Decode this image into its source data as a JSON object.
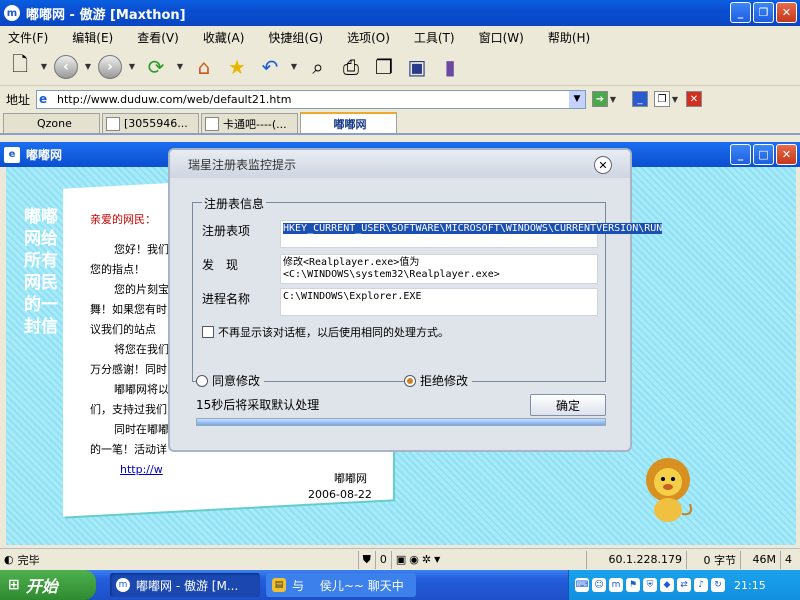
{
  "window": {
    "title": "嘟嘟网 - 傲游 [Maxthon]",
    "app_icon": "m"
  },
  "menu": [
    "文件(F)",
    "编辑(E)",
    "查看(V)",
    "收藏(A)",
    "快捷组(G)",
    "选项(O)",
    "工具(T)",
    "窗口(W)",
    "帮助(H)"
  ],
  "address": {
    "label": "地址",
    "url": "http://www.duduw.com/web/default21.htm"
  },
  "tabs": [
    "Qzone",
    "[3055946...",
    "卡通吧----(...",
    "嘟嘟网"
  ],
  "inner_window": {
    "title": "嘟嘟网"
  },
  "page": {
    "sidebar_text": "嘟嘟网给所有网民的一封信",
    "letter": {
      "greeting": "亲爱的网民：",
      "lines": [
        "您好！我们",
        "您的指点！",
        "您的片刻宝",
        "舞！如果您有时",
        "议我们的站点",
        "将您在我们",
        "万分感谢！同时",
        "嘟嘟网将以",
        "们，支持过我们",
        "同时在嘟嘟",
        "的一笔！活动详"
      ],
      "link": "http://w",
      "signature": "嘟嘟网",
      "date": "2006-08-22"
    }
  },
  "dialog": {
    "title": "瑞星注册表监控提示",
    "group_label": "注册表信息",
    "label_key": "注册表项",
    "value_key": "HKEY_CURRENT_USER\\SOFTWARE\\MICROSOFT\\WINDOWS\\CURRENTVERSION\\RUN",
    "label_found": "发　现",
    "value_found": "修改<Realplayer.exe>值为<C:\\WINDOWS\\system32\\Realplayer.exe>",
    "label_process": "进程名称",
    "value_process": "C:\\WINDOWS\\Explorer.EXE",
    "checkbox_label": "不再显示该对话框，以后使用相同的处理方式。",
    "radio_allow": "同意修改",
    "radio_deny": "拒绝修改",
    "countdown_text": "15秒后将采取默认处理",
    "ok_label": "确定",
    "progress": 1.0
  },
  "status": {
    "text": "完毕",
    "count": "0",
    "ip": "60.1.228.179",
    "bytes": "0 字节",
    "memory": "46M",
    "num": "4"
  },
  "taskbar": {
    "start": "开始",
    "tasks": [
      "嘟嘟网 - 傲游 [M...",
      "与　 侯儿~~ 聊天中"
    ],
    "clock": "21:15"
  }
}
